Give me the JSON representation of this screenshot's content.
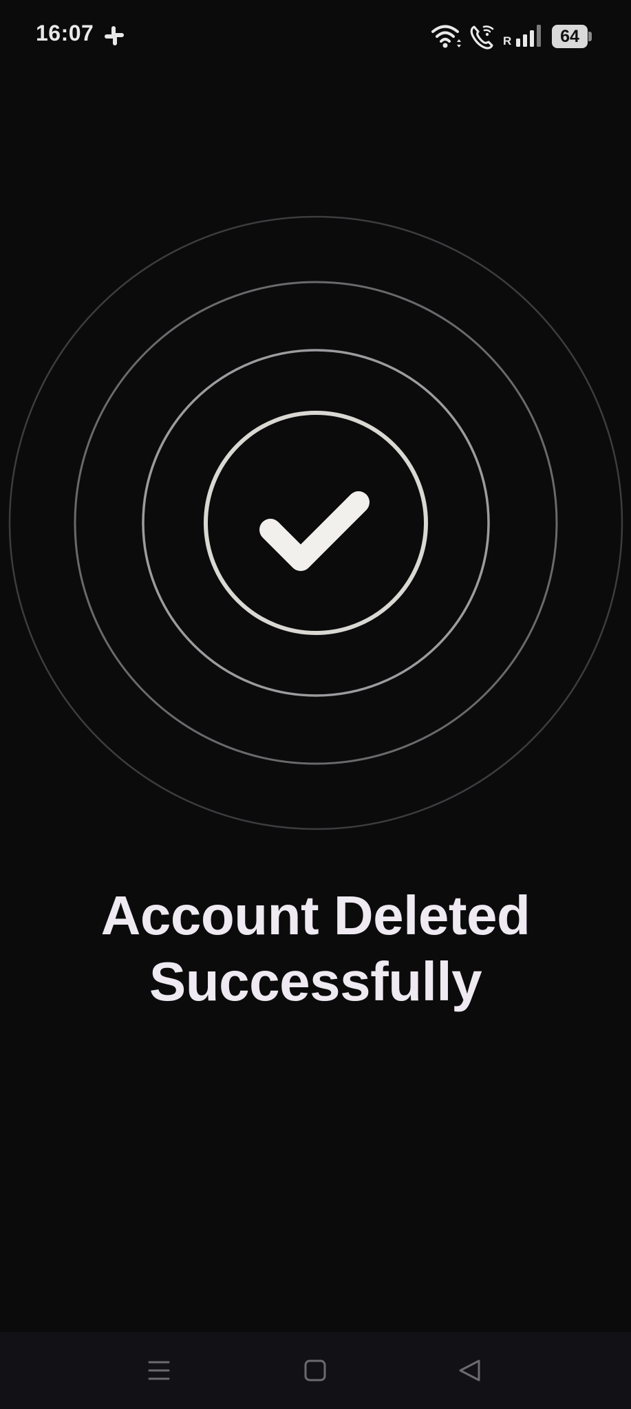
{
  "status_bar": {
    "time": "16:07",
    "roaming_label": "R",
    "battery_level": "64",
    "icons": [
      "slack-icon",
      "wifi-icon",
      "wifi-calling-icon",
      "signal-icon",
      "battery-icon"
    ]
  },
  "main": {
    "success_icon": "check-circle-icon",
    "headline_line1": "Account Deleted",
    "headline_line2": "Successfully"
  },
  "nav_bar": {
    "icons": [
      "menu-icon",
      "home-icon",
      "back-icon"
    ]
  },
  "colors": {
    "background": "#0b0b0c",
    "text": "#efe9f1",
    "nav_background": "#111116"
  }
}
